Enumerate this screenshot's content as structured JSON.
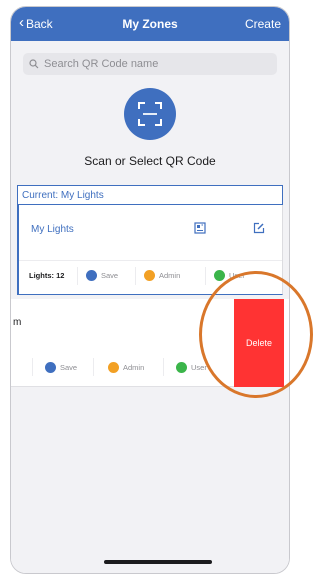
{
  "colors": {
    "accent": "#3f6fbf",
    "delete": "#ff3333",
    "callout": "#d9772b",
    "save": "#3f6fbf",
    "admin": "#f2a024",
    "user": "#3bb54a"
  },
  "navbar": {
    "back_label": "Back",
    "title": "My Zones",
    "create_label": "Create"
  },
  "search": {
    "placeholder": "Search QR Code name"
  },
  "scan": {
    "label": "Scan or Select QR Code",
    "icon": "qr-scan-icon"
  },
  "current": {
    "label": "Current: My Lights"
  },
  "zones": [
    {
      "name": "My Lights",
      "lights_label": "Lights: 12",
      "actions": {
        "save": "Save",
        "admin": "Admin",
        "user": "User"
      }
    },
    {
      "name": "m",
      "actions": {
        "save": "Save",
        "admin": "Admin",
        "user": "User"
      },
      "delete_label": "Delete"
    }
  ]
}
